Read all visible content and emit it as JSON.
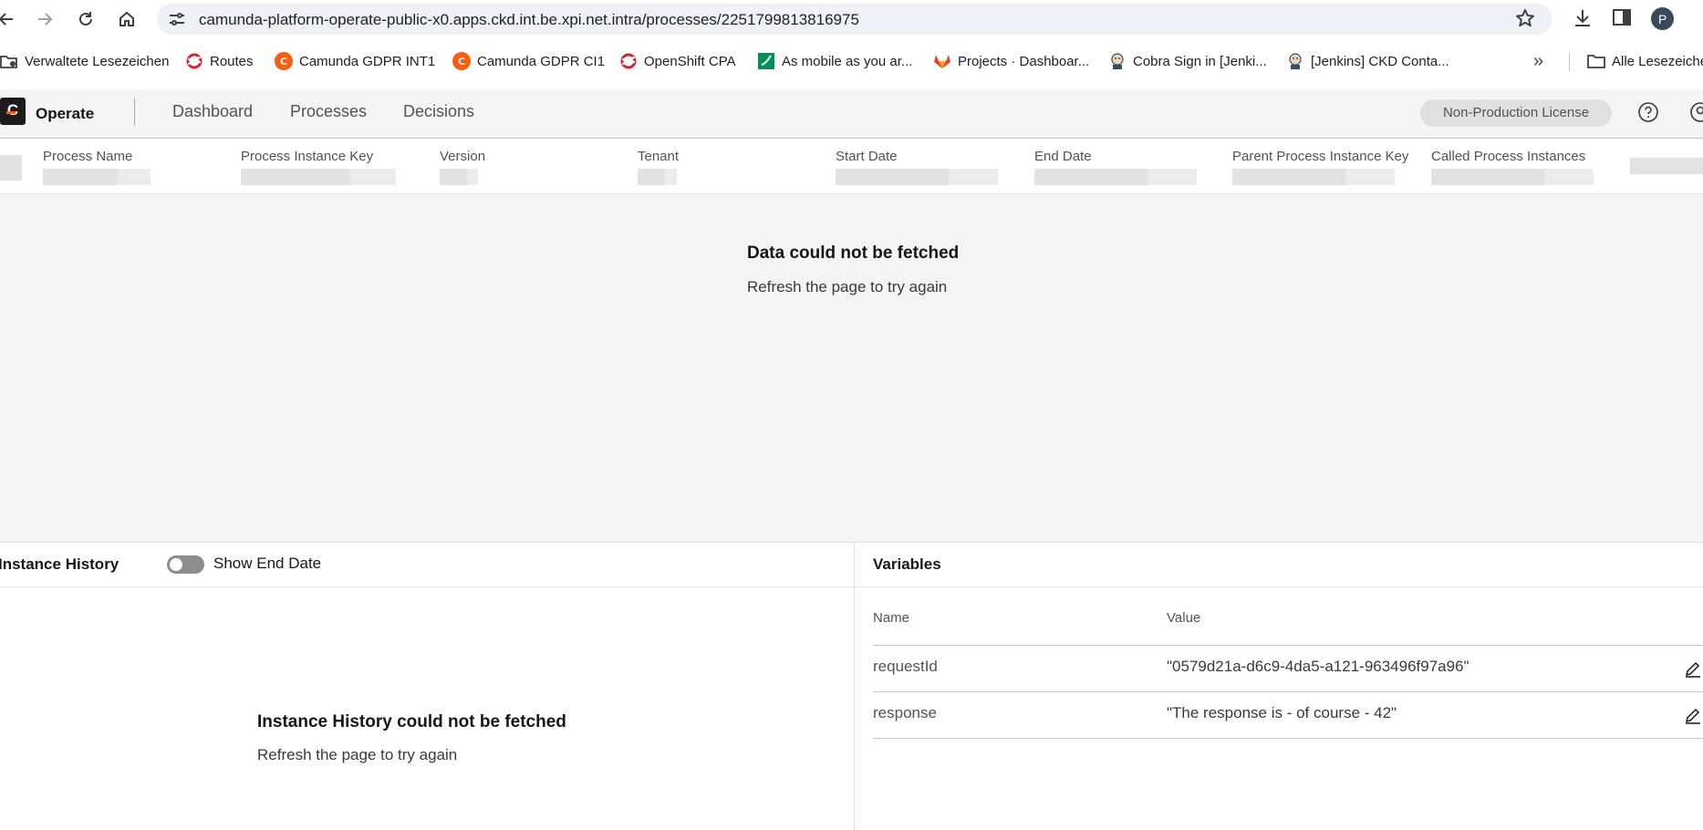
{
  "browser": {
    "url": "camunda-platform-operate-public-x0.apps.ckd.int.be.xpi.net.intra/processes/2251799813816975",
    "profile_initial": "P",
    "bookmarks": [
      {
        "label": "Verwaltete Lesezeichen",
        "icon": "managed-bookmarks-icon"
      },
      {
        "label": "Routes",
        "icon": "openshift-icon"
      },
      {
        "label": "Camunda GDPR INT1",
        "icon": "camunda-icon"
      },
      {
        "label": "Camunda GDPR CI1",
        "icon": "camunda-icon"
      },
      {
        "label": "OpenShift CPA",
        "icon": "openshift-icon"
      },
      {
        "label": "As mobile as you ar...",
        "icon": "bank-icon"
      },
      {
        "label": "Projects · Dashboar...",
        "icon": "gitlab-icon"
      },
      {
        "label": "Cobra Sign in [Jenki...",
        "icon": "jenkins-icon"
      },
      {
        "label": "[Jenkins] CKD Conta...",
        "icon": "jenkins-icon"
      }
    ],
    "all_bookmarks_label": "Alle Lesezeichen"
  },
  "app": {
    "logo_letter": "C",
    "brand": "Operate",
    "nav": [
      "Dashboard",
      "Processes",
      "Decisions"
    ],
    "license": "Non-Production License"
  },
  "instance_header": {
    "columns": [
      "Process Name",
      "Process Instance Key",
      "Version",
      "Tenant",
      "Start Date",
      "End Date",
      "Parent Process Instance Key",
      "Called Process Instances"
    ]
  },
  "main_error": {
    "title": "Data could not be fetched",
    "subtitle": "Refresh the page to try again"
  },
  "instance_history": {
    "title": "Instance History",
    "toggle_label": "Show End Date",
    "toggle_on": false,
    "error_title": "Instance History could not be fetched",
    "error_subtitle": "Refresh the page to try again"
  },
  "variables": {
    "title": "Variables",
    "headers": {
      "name": "Name",
      "value": "Value"
    },
    "rows": [
      {
        "name": "requestId",
        "value": "\"0579d21a-d6c9-4da5-a121-963496f97a96\""
      },
      {
        "name": "response",
        "value": "\"The response is - of course - 42\""
      }
    ]
  },
  "colors": {
    "accent_orange": "#fc5d0d",
    "header_bg": "#f4f4f4",
    "license_bg": "#e0e0e0"
  }
}
